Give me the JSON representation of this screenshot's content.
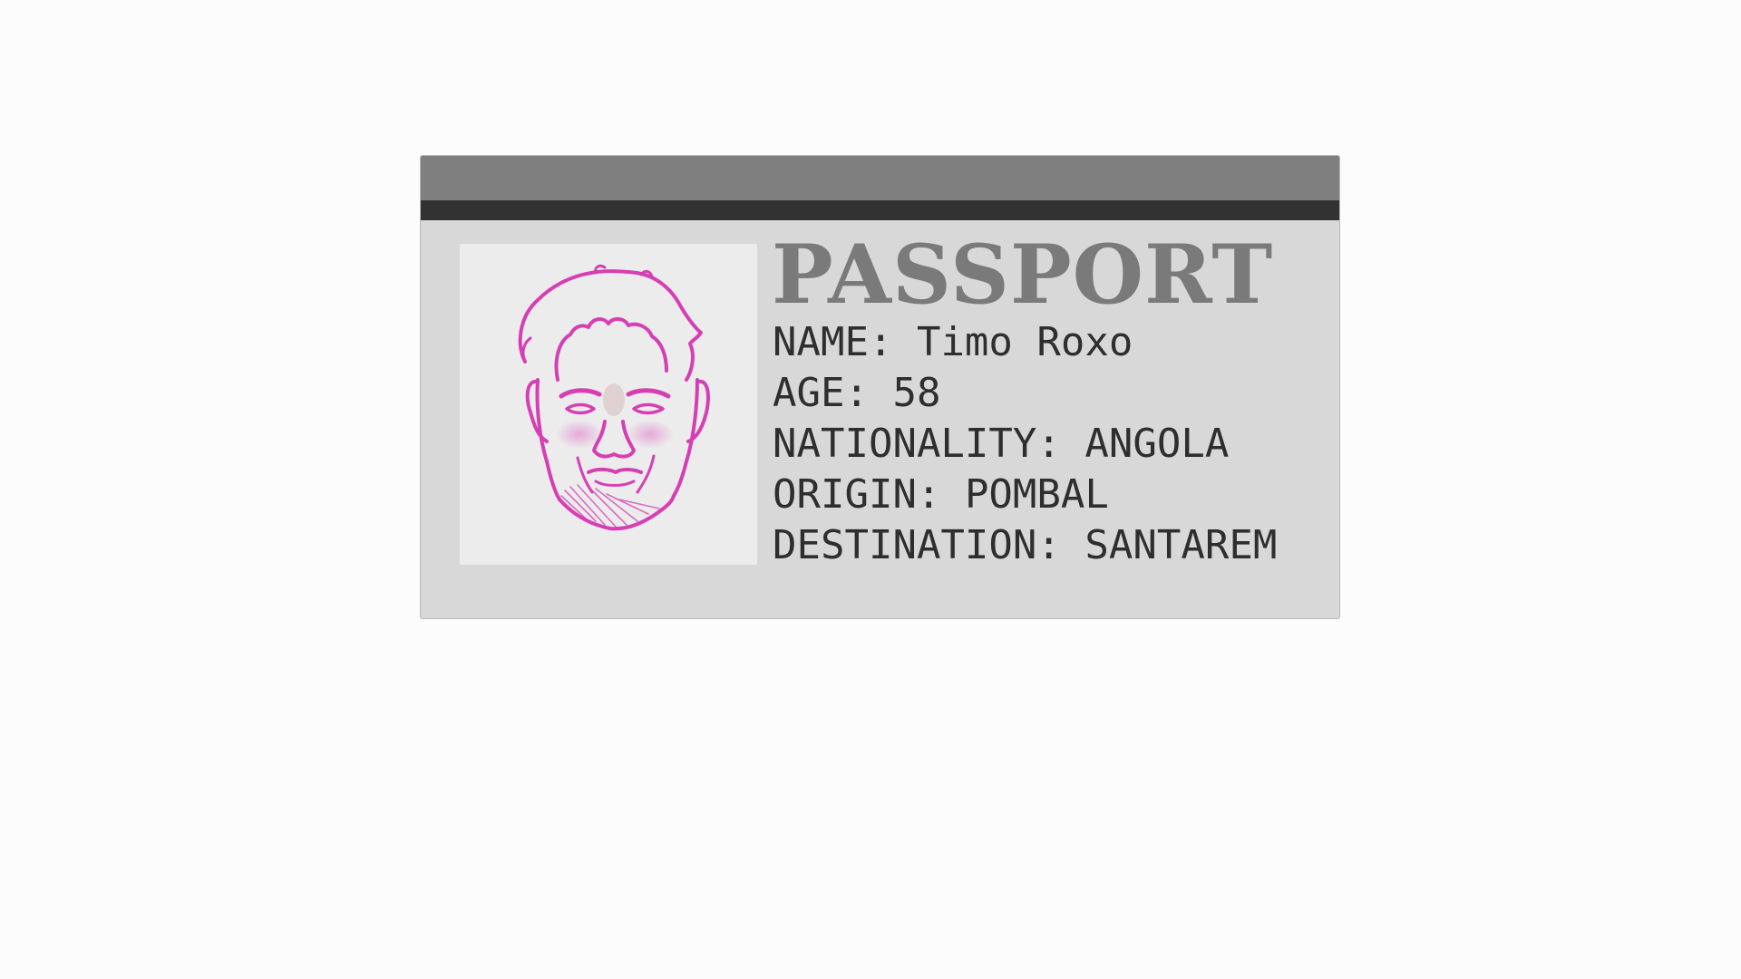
{
  "passport": {
    "title": "PASSPORT",
    "photo": {
      "icon": "face-sketch-icon",
      "ink_color": "#d63fb4"
    },
    "fields": [
      {
        "label": "NAME:",
        "value": "Timo Roxo"
      },
      {
        "label": "AGE:",
        "value": "58"
      },
      {
        "label": "NATIONALITY:",
        "value": "ANGOLA"
      },
      {
        "label": "ORIGIN:",
        "value": "POMBAL"
      },
      {
        "label": "DESTINATION:",
        "value": "SANTAREM"
      }
    ]
  },
  "colors": {
    "card": "#d8d8d8",
    "header_band": "#7f7f7f",
    "header_strip": "#323232",
    "photo_bg": "#ececec",
    "title_text": "#7a7a7a",
    "field_text": "#2e2e2e"
  }
}
